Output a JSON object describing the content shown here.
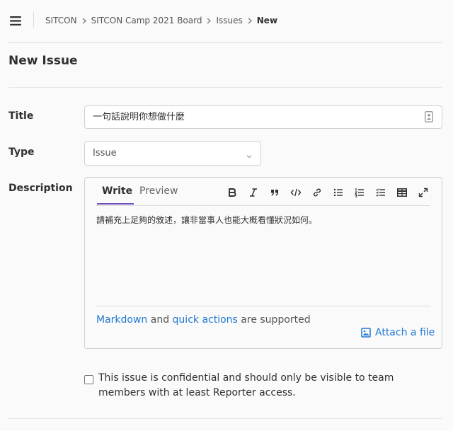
{
  "breadcrumb": [
    "SITCON",
    "SITCON Camp 2021 Board",
    "Issues",
    "New"
  ],
  "page_title": "New Issue",
  "form": {
    "title_label": "Title",
    "title_value": "一句話說明你想做什麼",
    "type_label": "Type",
    "type_value": "Issue",
    "description_label": "Description"
  },
  "editor": {
    "tab_write": "Write",
    "tab_preview": "Preview",
    "toolbar": [
      "bold-icon",
      "italic-icon",
      "quote-icon",
      "code-icon",
      "link-icon",
      "bullet-list-icon",
      "numbered-list-icon",
      "task-list-icon",
      "table-icon",
      "fullscreen-icon"
    ],
    "content": "請補充上足夠的敘述，讓非當事人也能大概看懂狀況如何。",
    "help_markdown": "Markdown",
    "help_and": " and ",
    "help_quick_actions": "quick actions",
    "help_supported": " are supported",
    "attach_label": "Attach a file"
  },
  "confidential": {
    "checked": false,
    "label": "This issue is confidential and should only be visible to team members with at least Reporter access."
  },
  "colors": {
    "link": "#1f78d1",
    "tab_active": "#6b4fbb",
    "background": "#fafafa"
  }
}
